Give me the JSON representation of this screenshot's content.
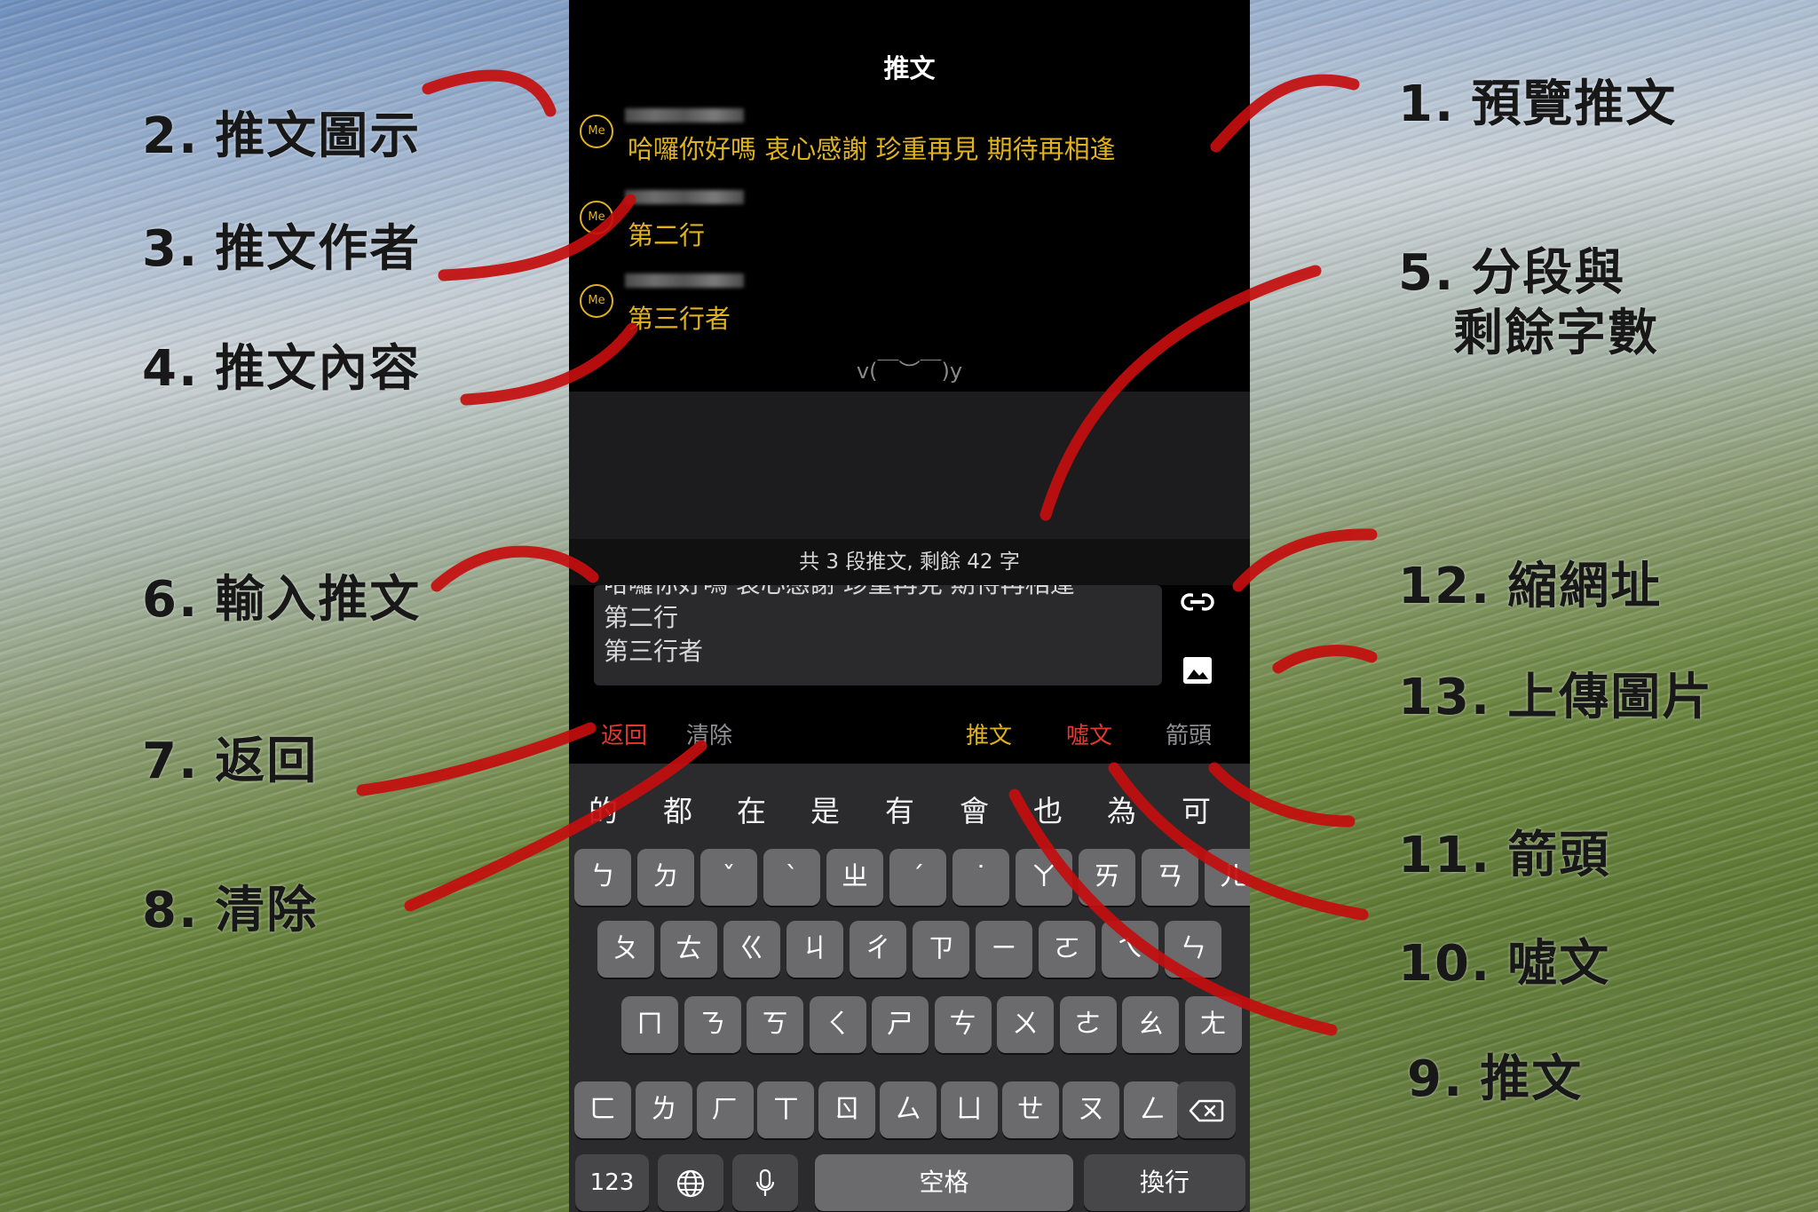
{
  "app": {
    "title": "推文"
  },
  "preview": {
    "avatar_label": "Me",
    "rows": [
      {
        "text": "哈囉你好嗎 衷心感謝 珍重再見 期待再相逢"
      },
      {
        "text": "第二行"
      },
      {
        "text": "第三行者"
      }
    ],
    "emoticon": "v(￣︶￣)y"
  },
  "status": {
    "text": "共 3 段推文, 剩餘 42 字"
  },
  "editor": {
    "lines": [
      "哈囉你好嗎 衷心感謝 珍重再見 期待再相逢",
      "第二行",
      "第三行者"
    ]
  },
  "side_icons": {
    "shorten_url": "link-icon",
    "upload_image": "image-icon"
  },
  "toolbar": {
    "back": "返回",
    "clear": "清除",
    "tweet": "推文",
    "boo": "噓文",
    "arrow": "箭頭",
    "colors": {
      "back": "#e03a2f",
      "clear": "#8e8e93",
      "tweet": "#e0b21f",
      "boo": "#e03a2f",
      "arrow": "#8e8e93"
    }
  },
  "keyboard": {
    "candidates": [
      "的",
      "都",
      "在",
      "是",
      "有",
      "會",
      "也",
      "為",
      "可"
    ],
    "row1": [
      "ㄅ",
      "ㄉ",
      "ˇ",
      "ˋ",
      "ㄓ",
      "ˊ",
      "˙",
      "ㄚ",
      "ㄞ",
      "ㄢ",
      "ㄦ"
    ],
    "row2": [
      "ㄆ",
      "ㄊ",
      "ㄍ",
      "ㄐ",
      "ㄔ",
      "ㄗ",
      "ㄧ",
      "ㄛ",
      "ㄟ",
      "ㄣ"
    ],
    "row3": [
      "ㄇ",
      "ㄋ",
      "ㄎ",
      "ㄑ",
      "ㄕ",
      "ㄘ",
      "ㄨ",
      "ㄜ",
      "ㄠ",
      "ㄤ"
    ],
    "row4": [
      "ㄈ",
      "ㄌ",
      "ㄏ",
      "ㄒ",
      "ㄖ",
      "ㄙ",
      "ㄩ",
      "ㄝ",
      "ㄡ",
      "ㄥ"
    ],
    "delete_icon": "backspace-icon",
    "bottom": {
      "numbers": "123",
      "globe_icon": "globe-icon",
      "mic_icon": "microphone-icon",
      "space": "空格",
      "return": "換行"
    }
  },
  "annotations": [
    {
      "num": "1.",
      "label": "預覽推文"
    },
    {
      "num": "2.",
      "label": "推文圖示"
    },
    {
      "num": "3.",
      "label": "推文作者"
    },
    {
      "num": "4.",
      "label": "推文內容"
    },
    {
      "num": "5.",
      "label": "分段與",
      "label2": "剩餘字數"
    },
    {
      "num": "6.",
      "label": "輸入推文"
    },
    {
      "num": "7.",
      "label": "返回"
    },
    {
      "num": "8.",
      "label": "清除"
    },
    {
      "num": "9.",
      "label": "推文"
    },
    {
      "num": "10.",
      "label": "噓文"
    },
    {
      "num": "11.",
      "label": "箭頭"
    },
    {
      "num": "12.",
      "label": "縮網址"
    },
    {
      "num": "13.",
      "label": "上傳圖片"
    }
  ]
}
